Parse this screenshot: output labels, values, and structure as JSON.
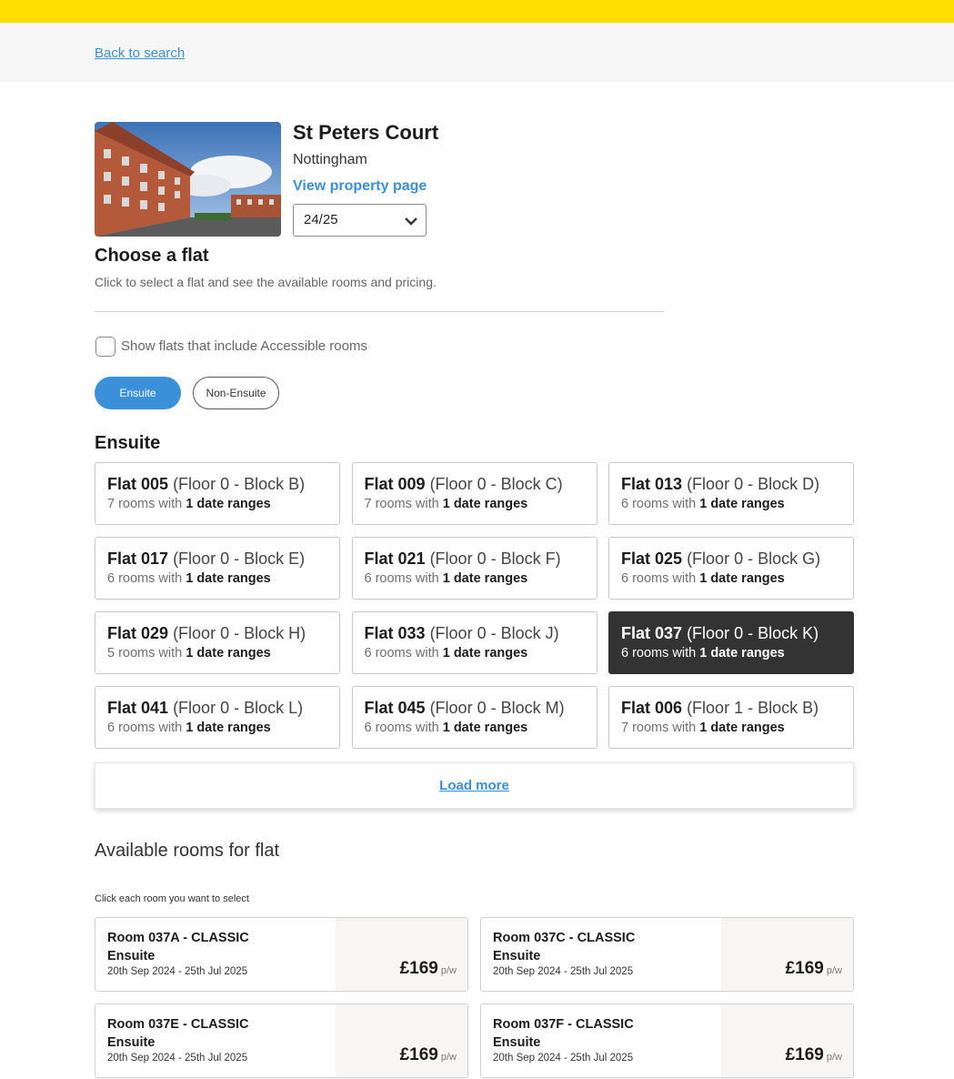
{
  "nav": {
    "back_link": "Back to search"
  },
  "property": {
    "name": "St Peters Court",
    "city": "Nottingham",
    "view_link": "View property page",
    "year_selected": "24/25"
  },
  "choose": {
    "title": "Choose a flat",
    "subtitle": "Click to select a flat and see the available rooms and pricing.",
    "accessible_label": "Show flats that include Accessible rooms"
  },
  "filters": {
    "ensuite": "Ensuite",
    "non_ensuite": "Non-Ensuite"
  },
  "section_title": "Ensuite",
  "flats": [
    {
      "name": "Flat 005",
      "floor": "(Floor 0 - Block B)",
      "rooms": "7 rooms with",
      "ranges": "1 date ranges",
      "selected": false
    },
    {
      "name": "Flat 009",
      "floor": "(Floor 0 - Block C)",
      "rooms": "7 rooms with",
      "ranges": "1 date ranges",
      "selected": false
    },
    {
      "name": "Flat 013",
      "floor": "(Floor 0 - Block D)",
      "rooms": "6 rooms with",
      "ranges": "1 date ranges",
      "selected": false
    },
    {
      "name": "Flat 017",
      "floor": "(Floor 0 - Block E)",
      "rooms": "6 rooms with",
      "ranges": "1 date ranges",
      "selected": false
    },
    {
      "name": "Flat 021",
      "floor": "(Floor 0 - Block F)",
      "rooms": "6 rooms with",
      "ranges": "1 date ranges",
      "selected": false
    },
    {
      "name": "Flat 025",
      "floor": "(Floor 0 - Block G)",
      "rooms": "6 rooms with",
      "ranges": "1 date ranges",
      "selected": false
    },
    {
      "name": "Flat 029",
      "floor": "(Floor 0 - Block H)",
      "rooms": "5 rooms with",
      "ranges": "1 date ranges",
      "selected": false
    },
    {
      "name": "Flat 033",
      "floor": "(Floor 0 - Block J)",
      "rooms": "6 rooms with",
      "ranges": "1 date ranges",
      "selected": false
    },
    {
      "name": "Flat 037",
      "floor": "(Floor 0 - Block K)",
      "rooms": "6 rooms with",
      "ranges": "1 date ranges",
      "selected": true
    },
    {
      "name": "Flat 041",
      "floor": "(Floor 0 - Block L)",
      "rooms": "6 rooms with",
      "ranges": "1 date ranges",
      "selected": false
    },
    {
      "name": "Flat 045",
      "floor": "(Floor 0 - Block M)",
      "rooms": "6 rooms with",
      "ranges": "1 date ranges",
      "selected": false
    },
    {
      "name": "Flat 006",
      "floor": "(Floor 1 - Block B)",
      "rooms": "7 rooms with",
      "ranges": "1 date ranges",
      "selected": false
    }
  ],
  "load_more": "Load more",
  "available": {
    "title": "Available rooms for flat",
    "subtitle": "Click each room you want to select"
  },
  "rooms": [
    {
      "name": "Room 037A - CLASSIC",
      "type": "Ensuite",
      "dates": "20th Sep 2024 - 25th Jul 2025",
      "price": "£169",
      "unit": "p/w"
    },
    {
      "name": "Room 037C - CLASSIC",
      "type": "Ensuite",
      "dates": "20th Sep 2024 - 25th Jul 2025",
      "price": "£169",
      "unit": "p/w"
    },
    {
      "name": "Room 037E - CLASSIC",
      "type": "Ensuite",
      "dates": "20th Sep 2024 - 25th Jul 2025",
      "price": "£169",
      "unit": "p/w"
    },
    {
      "name": "Room 037F - CLASSIC",
      "type": "Ensuite",
      "dates": "20th Sep 2024 - 25th Jul 2025",
      "price": "£169",
      "unit": "p/w"
    }
  ],
  "colors": {
    "brand_yellow": "#ffde00",
    "link_blue": "#3a8fd6",
    "active_pill": "#3a90d9",
    "selected_card": "#333333"
  }
}
